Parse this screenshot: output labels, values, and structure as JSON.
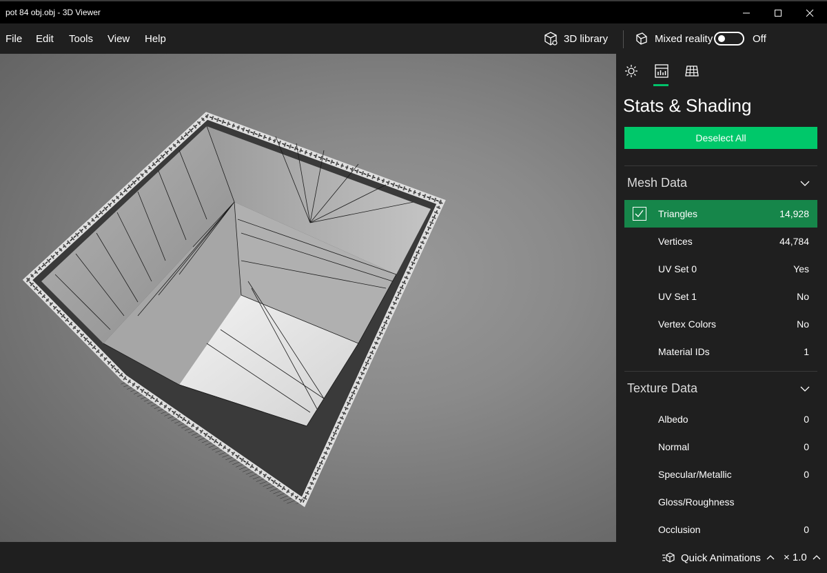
{
  "window": {
    "title": "pot 84 obj.obj - 3D Viewer",
    "controls": {
      "minimize_icon": "minimize-icon",
      "maximize_icon": "maximize-icon",
      "close_icon": "close-icon"
    }
  },
  "menu": {
    "items": [
      "File",
      "Edit",
      "Tools",
      "View",
      "Help"
    ],
    "library_label": "3D library",
    "mixed_reality_label": "Mixed reality",
    "mixed_reality_state": "Off"
  },
  "panel": {
    "tabs": [
      {
        "name": "lighting",
        "icon": "sun-icon"
      },
      {
        "name": "stats",
        "icon": "stats-icon",
        "active": true
      },
      {
        "name": "grid",
        "icon": "grid-icon"
      }
    ],
    "title": "Stats & Shading",
    "deselect_label": "Deselect All",
    "mesh_section": {
      "title": "Mesh Data",
      "rows": [
        {
          "label": "Triangles",
          "value": "14,928",
          "selected": true
        },
        {
          "label": "Vertices",
          "value": "44,784"
        },
        {
          "label": "UV Set 0",
          "value": "Yes"
        },
        {
          "label": "UV Set 1",
          "value": "No"
        },
        {
          "label": "Vertex Colors",
          "value": "No"
        },
        {
          "label": "Material IDs",
          "value": "1"
        }
      ]
    },
    "texture_section": {
      "title": "Texture Data",
      "rows": [
        {
          "label": "Albedo",
          "value": "0"
        },
        {
          "label": "Normal",
          "value": "0"
        },
        {
          "label": "Specular/Metallic",
          "value": "0"
        },
        {
          "label": "Gloss/Roughness",
          "value": ""
        },
        {
          "label": "Occlusion",
          "value": "0"
        }
      ]
    }
  },
  "bottom": {
    "animations_label": "Quick Animations",
    "speed_label": "× 1.0"
  },
  "colors": {
    "accent": "#00c86a",
    "selected_row": "#16864a",
    "panel_bg": "#1f1f1f",
    "titlebar_bg": "#000000"
  }
}
